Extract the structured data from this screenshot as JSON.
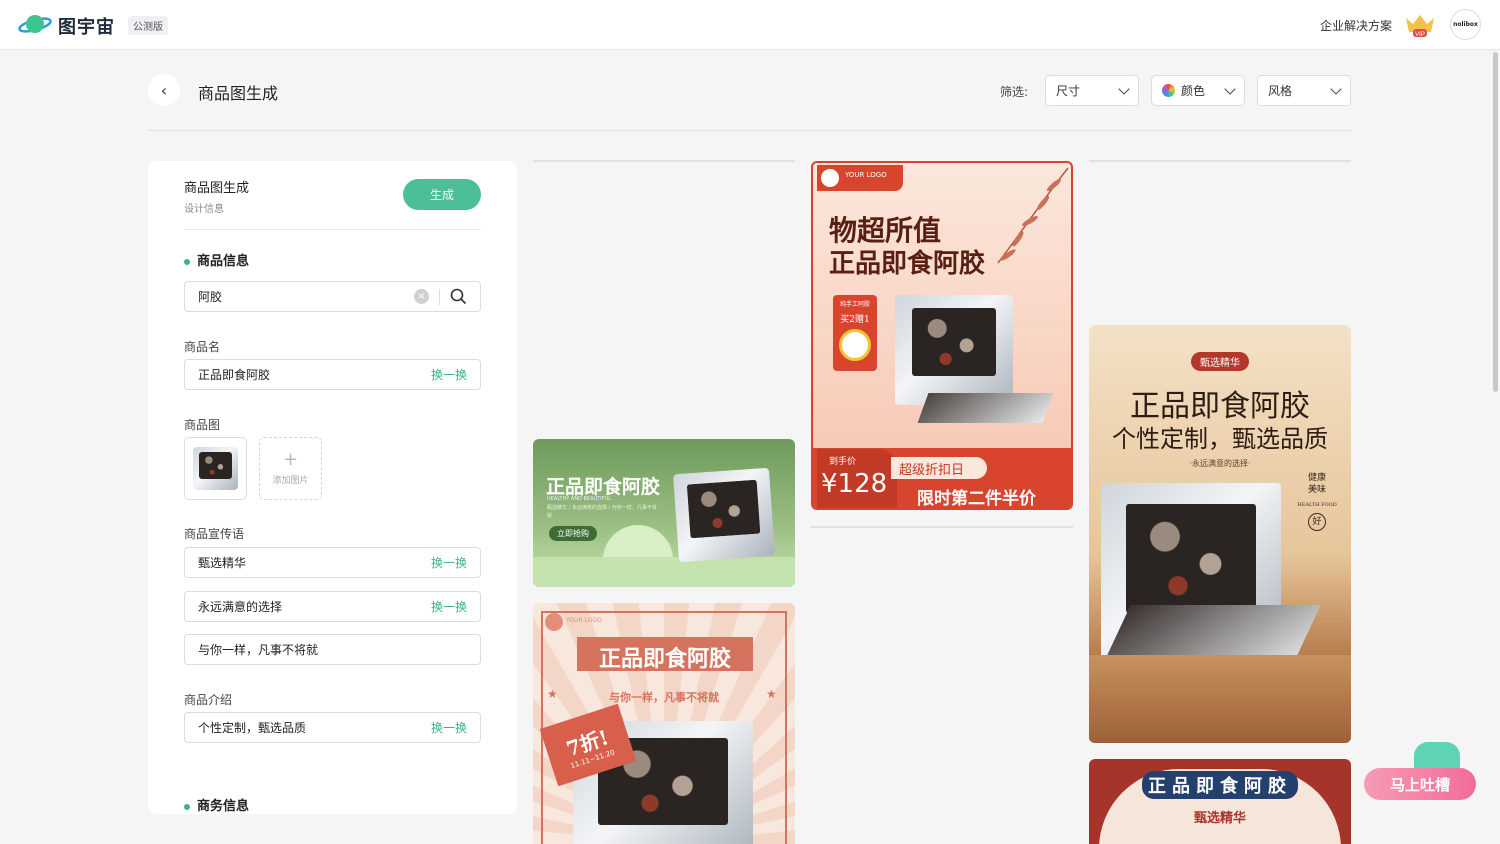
{
  "app": {
    "brand": "图宇宙",
    "badge": "公测版",
    "enterprise": "企业解决方案",
    "vip": "VIP",
    "avatar": "nolibox"
  },
  "page": {
    "title": "商品图生成",
    "filter_label": "筛选:",
    "filters": [
      "尺寸",
      "颜色",
      "风格"
    ]
  },
  "panel": {
    "title": "商品图生成",
    "subtitle": "设计信息",
    "generate": "生成",
    "section_product": "商品信息",
    "search_value": "阿胶",
    "name_label": "商品名",
    "name_value": "正品即食阿胶",
    "swap": "换一换",
    "image_label": "商品图",
    "add_image": "添加图片",
    "slogan_label": "商品宣传语",
    "slogans": [
      "甄选精华",
      "永远满意的选择",
      "与你一样，凡事不将就"
    ],
    "intro_label": "商品介绍",
    "intro_value": "个性定制，甄选品质",
    "section_business": "商务信息"
  },
  "cards": {
    "green": {
      "title": "正品即食阿胶",
      "sub": "HEALTHY AND BEAUTIFUL",
      "desc": "甄选精华 / 永远满意的选择 / 与你一样，凡事不将就",
      "btn": "立即抢购"
    },
    "red": {
      "logo": "YOUR LOGO",
      "line1": "物超所值",
      "line2": "正品即食阿胶",
      "tag1": "纯手工阿胶",
      "tag2": "买2赠1",
      "price_label": "到手价",
      "price": "¥128",
      "promo1": "超级折扣日",
      "promo2": "限时第二件半价"
    },
    "retro": {
      "logo": "YOUR LOGO",
      "title": "正品即食阿胶",
      "sub": "与你一样，凡事不将就",
      "discount": "7折!",
      "date": "11.11~11.20"
    },
    "beige": {
      "tag": "甄选精华",
      "line1": "正品即食阿胶",
      "line2": "个性定制，甄选品质",
      "sub": "·永远满意的选择·",
      "side1": "健康",
      "side2": "美味",
      "side3": "HEALTH FOOD",
      "side4": "好"
    },
    "navy": {
      "title": "正品即食阿胶",
      "sub": "甄选精华"
    }
  },
  "feedback": "马上吐槽",
  "colors": {
    "accent": "#4cbf97",
    "red": "#d9442e"
  }
}
